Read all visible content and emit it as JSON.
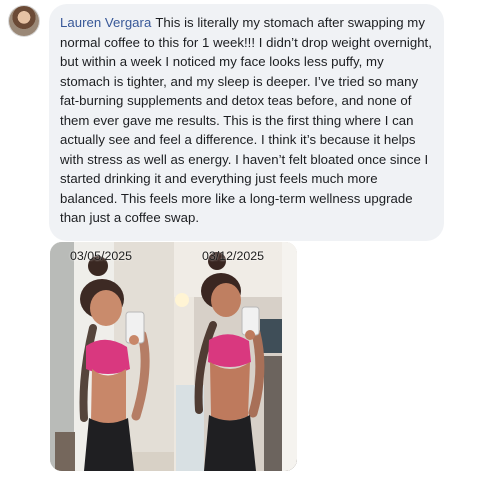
{
  "comment": {
    "author": "Lauren Vergara",
    "text": "This is literally my stomach after swapping my normal coffee to this for 1 week!!! I didn’t drop weight overnight, but within a week I noticed my face looks less puffy, my stomach is tighter, and my sleep is deeper. I’ve tried so many fat-burning supplements and detox teas before, and none of them ever gave me results. This is the first thing where I can actually see and feel a difference. I think it’s because it helps with stress as well as energy. I haven’t felt bloated once since I started drinking it and everything just feels much more balanced. This feels more like a long-term wellness upgrade than just a coffee swap."
  },
  "photos": {
    "before_date": "03/05/2025",
    "after_date": "03/12/2025"
  },
  "colors": {
    "author": "#385898",
    "bubble": "#f0f2f5",
    "text": "#1c1e21",
    "top": "#d9387f",
    "leggings": "#1f1f22"
  }
}
